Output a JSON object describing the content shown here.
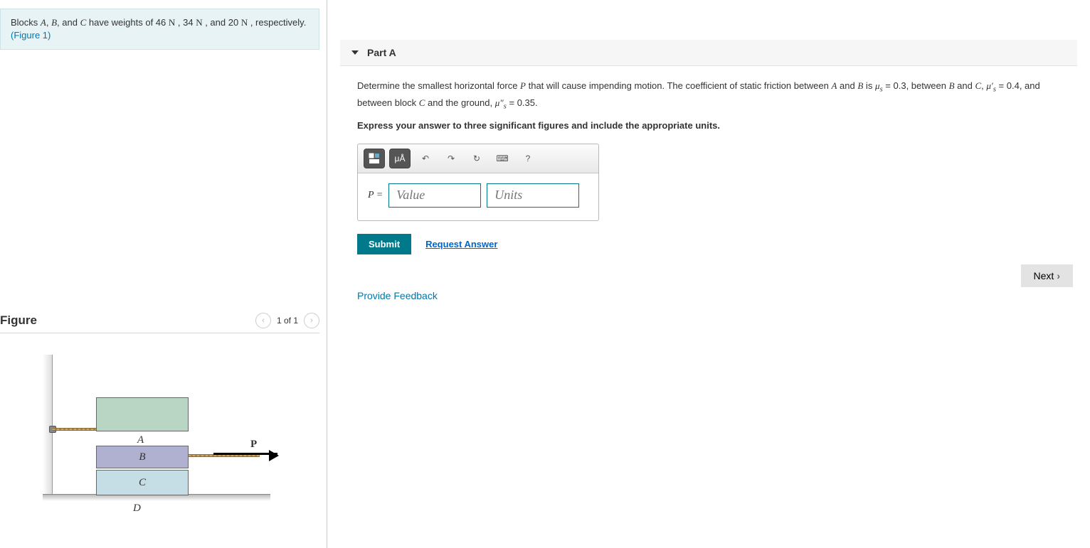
{
  "problem": {
    "intro_html": "Blocks <span class='math-it'>A</span>, <span class='math-it'>B</span>, and <span class='math-it'>C</span> have weights of 46 <span class='math-up'>N</span> , 34 <span class='math-up'>N</span> , and 20 <span class='math-up'>N</span> , respectively.",
    "figure_ref": "(Figure 1)"
  },
  "figure": {
    "title": "Figure",
    "nav_text": "1 of 1",
    "labels": {
      "A": "A",
      "B": "B",
      "C": "C",
      "D": "D",
      "P": "P"
    }
  },
  "part": {
    "title": "Part A",
    "question_html": "Determine the smallest horizontal force <span class='math-it'>P</span> that will cause impending motion. The coefficient of static friction between <span class='math-it'>A</span> and <span class='math-it'>B</span> is <span class='math-it'>μ<sub>s</sub></span> = 0.3, between <span class='math-it'>B</span> and <span class='math-it'>C</span>, <span class='math-it'>μ′<sub>s</sub></span> = 0.4, and between block <span class='math-it'>C</span> and the ground, <span class='math-it'>μ″<sub>s</sub></span> = 0.35.",
    "instruction": "Express your answer to three significant figures and include the appropriate units.",
    "var_label": "P =",
    "value_placeholder": "Value",
    "units_placeholder": "Units",
    "submit_label": "Submit",
    "request_answer_label": "Request Answer",
    "toolbar": {
      "template_icon": "▭",
      "units_icon": "μÅ",
      "undo_icon": "↶",
      "redo_icon": "↷",
      "reset_icon": "↻",
      "keyboard_icon": "⌨",
      "help_icon": "?"
    }
  },
  "footer": {
    "feedback": "Provide Feedback",
    "next": "Next"
  }
}
